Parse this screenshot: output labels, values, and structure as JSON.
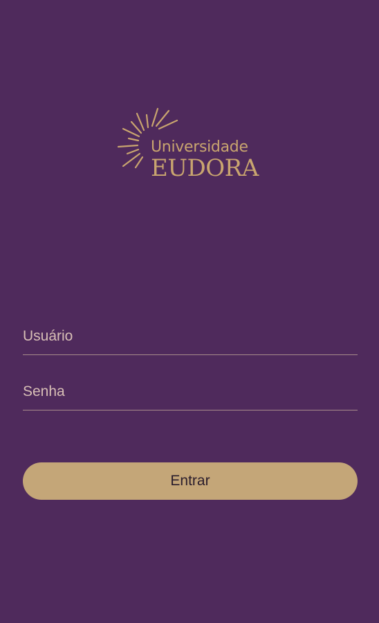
{
  "app": {
    "brand_line1": "Universidade",
    "brand_line2": "EUDORA",
    "brand_color": "#c9a56f",
    "background_color": "#4f2a5c"
  },
  "login": {
    "username_placeholder": "Usuário",
    "username_value": "",
    "password_placeholder": "Senha",
    "password_value": "",
    "submit_label": "Entrar",
    "button_color": "#c4a678"
  },
  "icons": {
    "logo_rays": "sunburst-icon"
  }
}
